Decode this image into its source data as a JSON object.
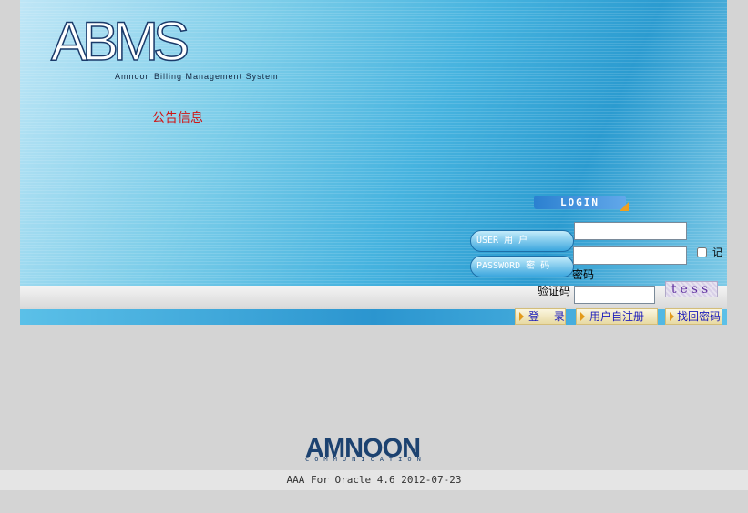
{
  "app": {
    "logo_text": "ABMS",
    "logo_subtitle": "Amnoon Billing Management System",
    "notice_link": "公告信息"
  },
  "login": {
    "badge": "LOGIN",
    "user_label": "USER 用 户",
    "password_label": "PASSWORD 密 码",
    "password_tag": "密码",
    "remember_label": "记",
    "captcha_label": "验证码",
    "captcha_text": "tess",
    "username_value": "",
    "password_value": "",
    "captcha_value": ""
  },
  "actions": {
    "login": "登 录",
    "register": "用户自注册",
    "recover": "找回密码"
  },
  "footer": {
    "company_logo": "AMNOON",
    "company_subtitle": "COMMUNICATION",
    "version": "AAA For Oracle 4.6 2012-07-23"
  },
  "colors": {
    "notice": "#d01414",
    "link": "#1c1cbb",
    "brand": "#1c4270"
  }
}
